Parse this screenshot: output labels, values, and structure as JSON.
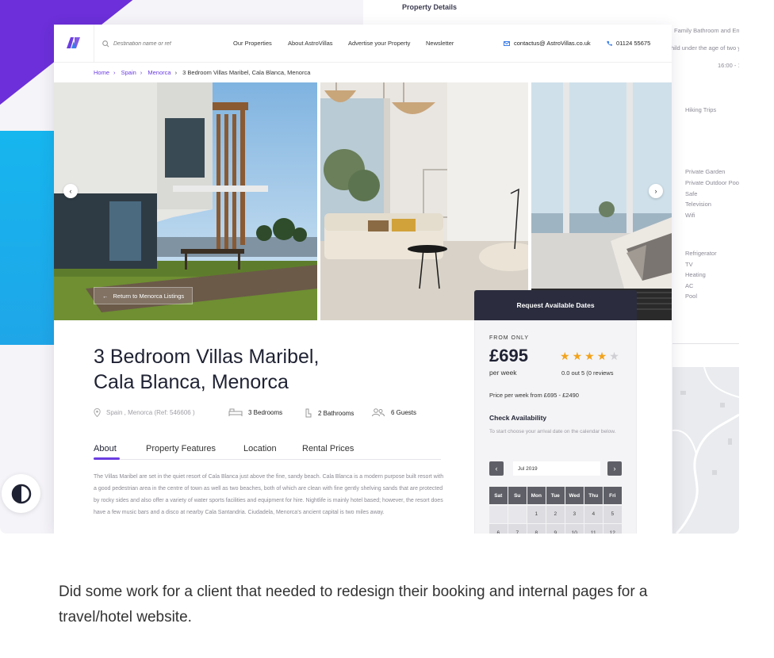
{
  "background": {
    "section_title": "Property Details",
    "right_panel_texts": [
      "Family Bathroom and En s",
      "hild under the age of two y",
      "16:00 - 1",
      "Hiking Trips",
      "Private Garden",
      "Private Outdoor Pool",
      "Safe",
      "Television",
      "Wifi",
      "Refrigerator",
      "TV",
      "Heating",
      "AC",
      "Pool"
    ]
  },
  "nav": {
    "logo_text": "AV",
    "search_placeholder": "Destination name or ref",
    "links": [
      "Our Properties",
      "About AstroVillas",
      "Advertise your Property",
      "Newsletter"
    ],
    "email": "contactus@ AstroVillas.co.uk",
    "phone": "01124 55675"
  },
  "breadcrumb": {
    "items": [
      "Home",
      "Spain",
      "Menorca"
    ],
    "current": "3 Bedroom Villas Maribel, Cala Blanca, Menorca"
  },
  "gallery": {
    "return_label": "Return to Menorca Listings"
  },
  "property": {
    "title_line1": "3 Bedroom Villas Maribel,",
    "title_line2": "Cala Blanca, Menorca",
    "location": "Spain , Menorca (Ref: 546606 )",
    "bedrooms": "3 Bedrooms",
    "bathrooms": "2 Bathrooms",
    "guests": "6 Guests"
  },
  "tabs": [
    "About",
    "Property Features",
    "Location",
    "Rental Prices"
  ],
  "about_text": "The Villas Maribel are set in the quiet resort of Cala Blanca just above the fine, sandy beach. Cala Blanca is a modern purpose built resort with a good pedestrian area in the centre of town as well as two beaches, both of which are clean with fine gently shelving sands that are protected by rocky sides and also offer a variety of water sports facilities and equipment for hire. Nightlife is mainly hotel based; however, the resort does have a few music bars and a disco at nearby Cala Santandria. Ciudadela, Menorca's ancient capital is two miles away.",
  "booking": {
    "header": "Request Available Dates",
    "from_label": "FROM ONLY",
    "price": "£695",
    "per_week": "per week",
    "rating": 4,
    "rating_max": 5,
    "reviews": "0.0 out 5 (0 reviews",
    "price_range": "Price per week from £695 - £2490",
    "check_title": "Check Availability",
    "check_sub": "To start choose your arrival date on the calendar below.",
    "month": "Jul 2019",
    "weekdays": [
      "Sat",
      "Su",
      "Mon",
      "Tue",
      "Wed",
      "Thu",
      "Fri"
    ],
    "days_row1": [
      "",
      "",
      "1",
      "2",
      "3",
      "4",
      "5"
    ],
    "days_row2": [
      "6",
      "7",
      "8",
      "9",
      "10",
      "11",
      "12"
    ]
  },
  "caption": "Did some work for a client that needed to redesign their booking and internal pages for a travel/hotel website.",
  "colors": {
    "accent": "#6b3de0",
    "purple_shape": "#6c2fd9",
    "blue_shape": "#16b6ef",
    "dark_panel": "#2b2d3e",
    "star": "#f2a31c"
  }
}
